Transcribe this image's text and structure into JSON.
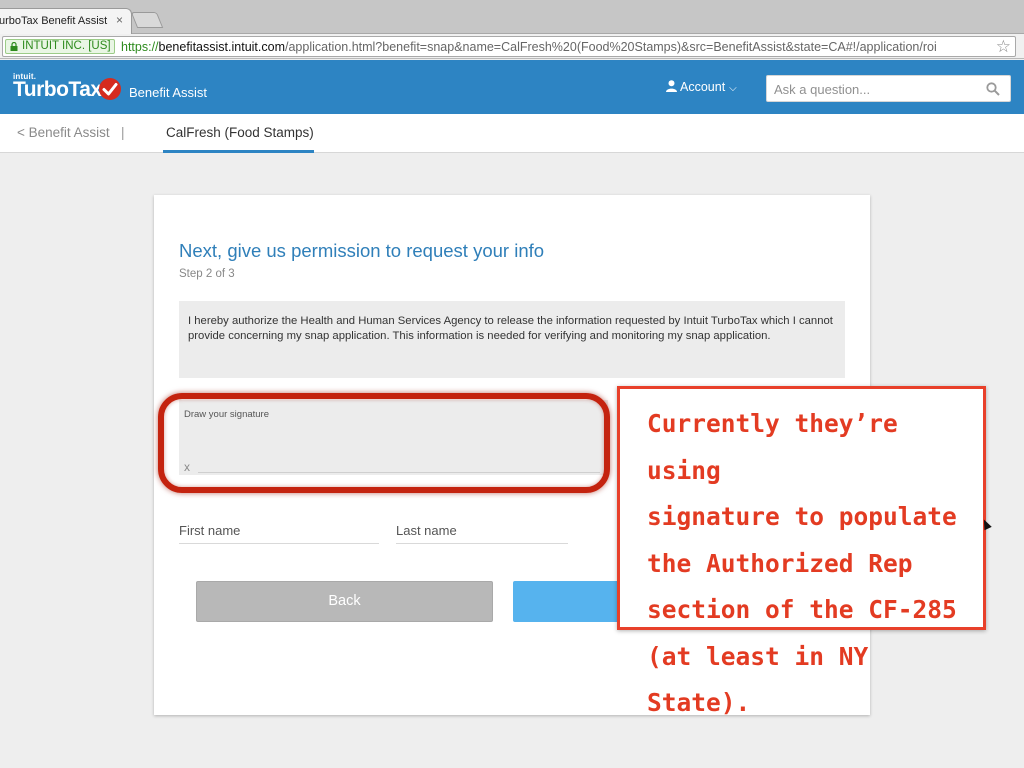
{
  "browser": {
    "tab_title": "urboTax Benefit Assist",
    "tab_close": "×",
    "ev_label": "INTUIT INC. [US]",
    "url_scheme": "https://",
    "url_host": "benefitassist.intuit.com",
    "url_rest": "/application.html?benefit=snap&name=CalFresh%20(Food%20Stamps)&src=BenefitAssist&state=CA#!/application/roi",
    "star": "☆"
  },
  "header": {
    "intuit": "intuit.",
    "logo": "TurboTax",
    "product": "Benefit Assist",
    "account_label": "Account",
    "account_chevron": "⌵",
    "search_placeholder": "Ask a question...",
    "brand_color": "#2d84c3"
  },
  "subnav": {
    "back_link": "< Benefit Assist",
    "separator": "|",
    "active_tab": "CalFresh (Food Stamps)"
  },
  "form": {
    "title": "Next, give us permission to request your info",
    "step": "Step 2 of 3",
    "consent_text": "I hereby authorize the Health and Human Services Agency to release the information requested by Intuit TurboTax which I cannot provide concerning my snap application. This information is needed for verifying and monitoring my snap application.",
    "signature_label": "Draw your signature",
    "signature_x": "x",
    "first_name_label": "First name",
    "last_name_label": "Last name",
    "back_button": "Back"
  },
  "annotation": {
    "lines": [
      "Currently they’re using",
      "signature to populate",
      "the Authorized Rep",
      "section of the CF-285",
      "(at least in NY State)."
    ],
    "color": "#e33b22"
  }
}
